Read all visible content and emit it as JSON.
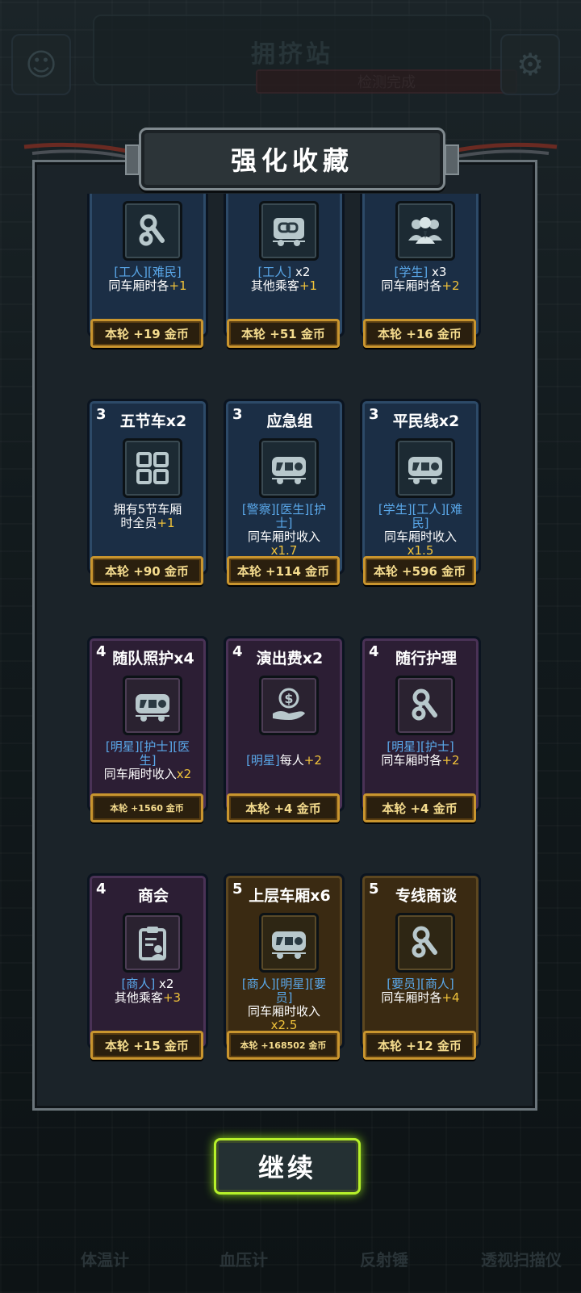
{
  "background": {
    "title": "拥挤站",
    "subtitle": "检测完成",
    "tools": [
      "体温计",
      "血压计",
      "反射锤",
      "透视扫描仪"
    ]
  },
  "modal": {
    "title": "强化收藏",
    "continue_label": "继续"
  },
  "cards": [
    {
      "tier": "",
      "name": "",
      "icon": "key-icon",
      "desc": [
        [
          {
            "t": "[工人][难民]",
            "c": "tag"
          }
        ],
        [
          {
            "t": "同车厢时各"
          },
          {
            "t": "+1",
            "c": "hl"
          }
        ]
      ],
      "reward": "本轮 +19 金币"
    },
    {
      "tier": "",
      "name": "",
      "icon": "coupler-icon",
      "desc": [
        [
          {
            "t": "[工人]",
            "c": "tag"
          },
          {
            "t": " x2"
          }
        ],
        [
          {
            "t": "其他乘客"
          },
          {
            "t": "+1",
            "c": "hl"
          }
        ]
      ],
      "reward": "本轮 +51 金币"
    },
    {
      "tier": "",
      "name": "",
      "icon": "group-icon",
      "desc": [
        [
          {
            "t": "[学生]",
            "c": "tag"
          },
          {
            "t": " x3"
          }
        ],
        [
          {
            "t": "同车厢时各"
          },
          {
            "t": "+2",
            "c": "hl"
          }
        ]
      ],
      "reward": "本轮 +16 金币"
    },
    {
      "tier": "3",
      "name": "五节车x2",
      "icon": "grid-icon",
      "desc": [
        [
          {
            "t": "拥有5节车厢"
          }
        ],
        [
          {
            "t": "时全员"
          },
          {
            "t": "+1",
            "c": "hl"
          }
        ]
      ],
      "reward": "本轮 +90 金币"
    },
    {
      "tier": "3",
      "name": "应急组",
      "icon": "train-car-icon",
      "desc": [
        [
          {
            "t": "[警察][医生][护",
            "c": "tag"
          }
        ],
        [
          {
            "t": "士]",
            "c": "tag"
          }
        ],
        [
          {
            "t": "同车厢时收入"
          }
        ],
        [
          {
            "t": "x1.7",
            "c": "hl"
          }
        ]
      ],
      "reward": "本轮 +114 金币"
    },
    {
      "tier": "3",
      "name": "平民线x2",
      "icon": "train-car-icon",
      "desc": [
        [
          {
            "t": "[学生][工人][难",
            "c": "tag"
          }
        ],
        [
          {
            "t": "民]",
            "c": "tag"
          }
        ],
        [
          {
            "t": "同车厢时收入"
          }
        ],
        [
          {
            "t": "x1.5",
            "c": "hl"
          }
        ]
      ],
      "reward": "本轮 +596 金币"
    },
    {
      "tier": "4",
      "name": "随队照护x4",
      "icon": "train-car-icon",
      "desc": [
        [
          {
            "t": "[明星][护士][医",
            "c": "tag"
          }
        ],
        [
          {
            "t": "生]",
            "c": "tag"
          }
        ],
        [
          {
            "t": "同车厢时收入"
          },
          {
            "t": "x2",
            "c": "hl"
          }
        ]
      ],
      "reward": "本轮 +1560 金币"
    },
    {
      "tier": "4",
      "name": "演出费x2",
      "icon": "money-hand-icon",
      "desc": [
        [],
        [
          {
            "t": "[明星]",
            "c": "tag"
          },
          {
            "t": "每人"
          },
          {
            "t": "+2",
            "c": "hl"
          }
        ]
      ],
      "reward": "本轮 +4 金币"
    },
    {
      "tier": "4",
      "name": "随行护理",
      "icon": "key-icon",
      "desc": [
        [
          {
            "t": "[明星][护士]",
            "c": "tag"
          }
        ],
        [
          {
            "t": "同车厢时各"
          },
          {
            "t": "+2",
            "c": "hl"
          }
        ]
      ],
      "reward": "本轮 +4 金币"
    },
    {
      "tier": "4",
      "name": "商会",
      "icon": "clipboard-icon",
      "desc": [
        [
          {
            "t": "[商人]",
            "c": "tag"
          },
          {
            "t": " x2"
          }
        ],
        [
          {
            "t": "其他乘客"
          },
          {
            "t": "+3",
            "c": "hl"
          }
        ]
      ],
      "reward": "本轮 +15 金币"
    },
    {
      "tier": "5",
      "name": "上层车厢x6",
      "icon": "train-car-icon",
      "desc": [
        [
          {
            "t": "[商人][明星][要",
            "c": "tag"
          }
        ],
        [
          {
            "t": "员]",
            "c": "tag"
          }
        ],
        [
          {
            "t": "同车厢时收入"
          }
        ],
        [
          {
            "t": "x2.5",
            "c": "hl"
          }
        ]
      ],
      "reward": "本轮 +168502 金币"
    },
    {
      "tier": "5",
      "name": "专线商谈",
      "icon": "key-icon",
      "desc": [
        [
          {
            "t": "[要员][商人]",
            "c": "tag"
          }
        ],
        [
          {
            "t": "同车厢时各"
          },
          {
            "t": "+4",
            "c": "hl"
          }
        ]
      ],
      "reward": "本轮 +12 金币"
    }
  ],
  "colors": {
    "tag": "#5aa8ea",
    "highlight": "#f0c23a",
    "reward_text": "#f5dc8e",
    "continue_glow": "#b6f02a"
  }
}
